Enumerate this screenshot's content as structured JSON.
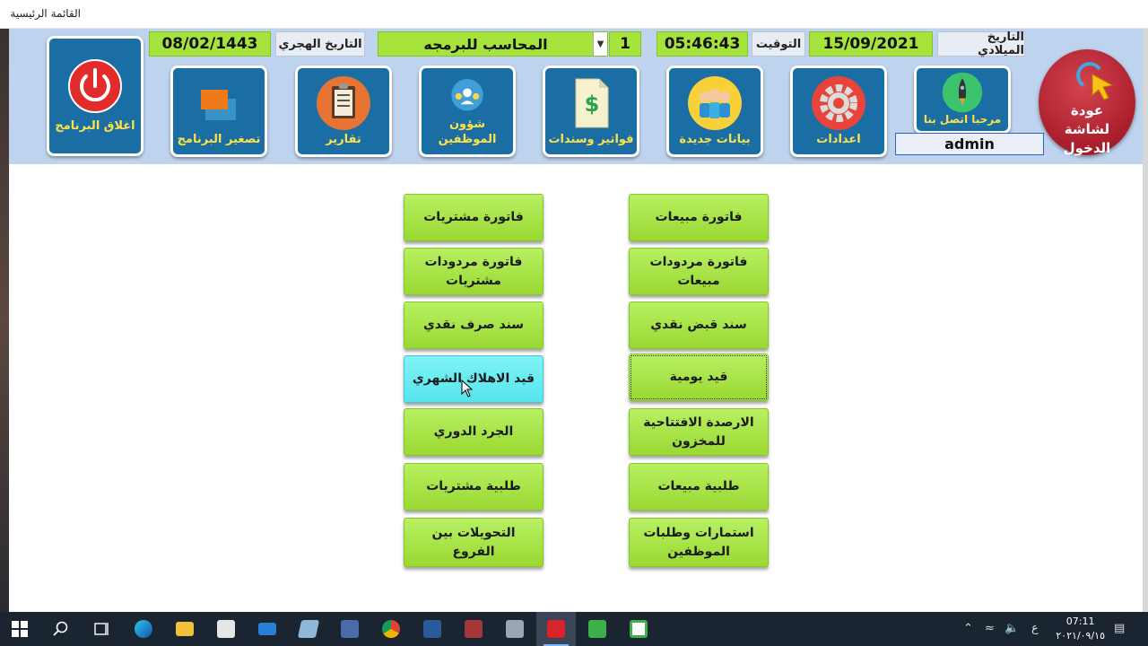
{
  "window": {
    "title": "القائمة الرئيسية"
  },
  "header": {
    "gregorian_label": "التاريخ الميلادي",
    "gregorian_date": "15/09/2021",
    "time_label": "التوقيت",
    "time": "05:46:43",
    "number_field": "1",
    "company_select": "المحاسب للبرمجه",
    "hijri_label": "التاريخ الهجري",
    "hijri_date": "08/02/1443"
  },
  "tiles": {
    "close": "اغلاق البرنامج",
    "minimize": "تصغير البرنامج",
    "reports": "تقارير",
    "employees": "شؤون الموظفين",
    "invoices": "فواتير وسندات",
    "new_data": "بيانات جديدة",
    "settings": "اعدادات",
    "contact": "مرحبا اتصل بنا",
    "back_to_login": "عودة لشاشة الدخول"
  },
  "user": {
    "name": "admin"
  },
  "menu_right": [
    "فاتورة مبيعات",
    "فاتورة مردودات مبيعات",
    "سند قبض نقدي",
    "قيد يومية",
    "الارصدة الافتتاحية للمخزون",
    "طلبية مبيعات",
    "استمارات وطلبات الموظفين"
  ],
  "menu_left": [
    "فاتورة مشتريات",
    "فاتورة مردودات مشتريات",
    "سند صرف نقدي",
    "قيد الاهلاك الشهري",
    "الجرد الدوري",
    "طلبية مشتريات",
    "التحويلات بين الفروع"
  ],
  "taskbar": {
    "time": "07:11",
    "date": "٢٠٢١/٠٩/١٥",
    "lang": "ع"
  },
  "colors": {
    "header_bg": "#bdd3ee",
    "tile_bg": "#1a6ea3",
    "tile_label": "#ffe24a",
    "button_green": "#a6e33c",
    "button_hover": "#7ff3f5",
    "back_button": "#a91e2c"
  }
}
